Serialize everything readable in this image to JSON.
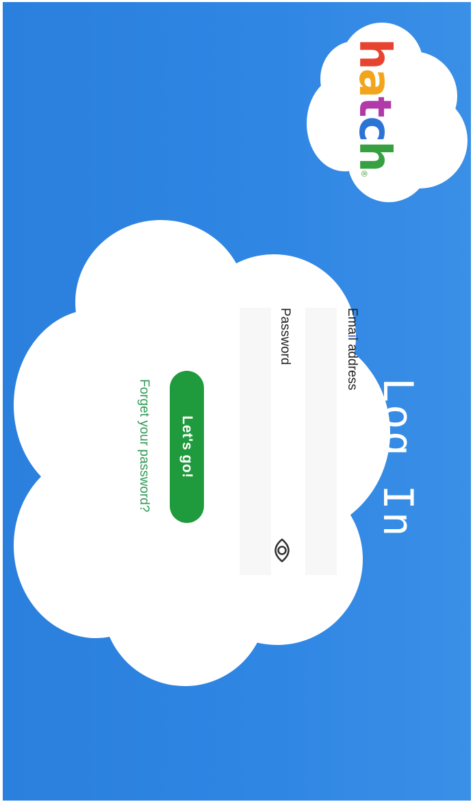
{
  "logo": {
    "letters": [
      {
        "char": "h",
        "color": "#e8432f"
      },
      {
        "char": "a",
        "color": "#f2a51c"
      },
      {
        "char": "t",
        "color": "#b23aa8"
      },
      {
        "char": "c",
        "color": "#2b74d6"
      },
      {
        "char": "h",
        "color": "#37a040"
      }
    ],
    "trademark": "®"
  },
  "page": {
    "title": "Log In"
  },
  "form": {
    "email_label_prefix": "Ema",
    "email_label_highlight": "i",
    "email_label_suffix": "l address",
    "email_value": "",
    "password_label": "Password",
    "password_value": "",
    "show_password_icon": "eye-icon",
    "submit_label": "Let's go!",
    "forgot_link": "Forget your password?"
  },
  "colors": {
    "background": "#2f86e3",
    "button": "#1f9a3c",
    "link": "#2e9a55",
    "cloud": "#ffffff"
  }
}
